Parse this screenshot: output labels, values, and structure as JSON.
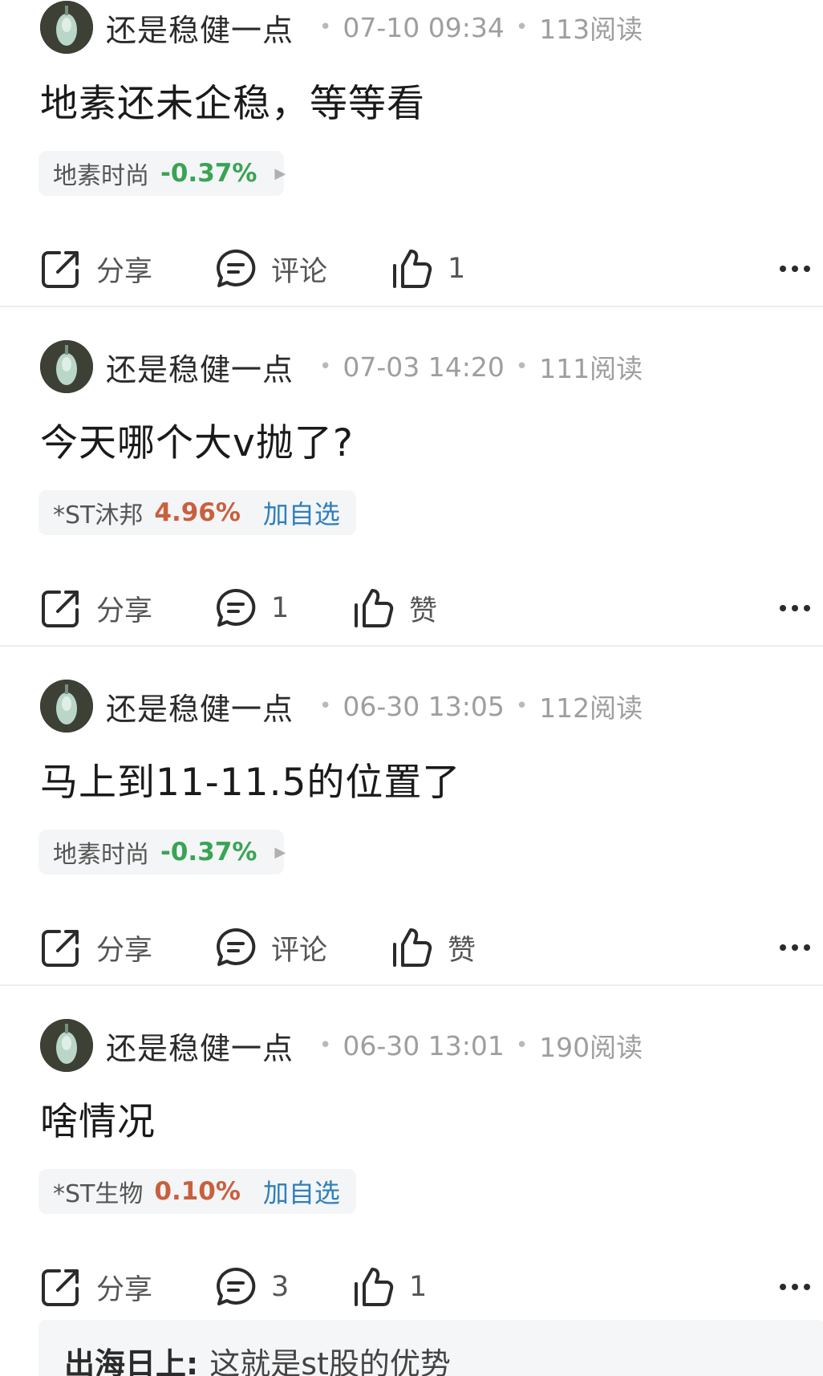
{
  "posts": [
    {
      "author": "还是稳健一点",
      "time": "07-10 09:34",
      "reads": "113阅读",
      "content": "地素还未企稳，等等看",
      "stock": {
        "name": "地素时尚",
        "change": "-0.37%",
        "direction": "down",
        "add_label": ""
      },
      "share_label": "分享",
      "comment_label": "评论",
      "like_label": "1"
    },
    {
      "author": "还是稳健一点",
      "time": "07-03 14:20",
      "reads": "111阅读",
      "content": "今天哪个大v抛了?",
      "stock": {
        "name": "*ST沐邦",
        "change": "4.96%",
        "direction": "up",
        "add_label": "加自选"
      },
      "share_label": "分享",
      "comment_label": "1",
      "like_label": "赞"
    },
    {
      "author": "还是稳健一点",
      "time": "06-30 13:05",
      "reads": "112阅读",
      "content": "马上到11-11.5的位置了",
      "stock": {
        "name": "地素时尚",
        "change": "-0.37%",
        "direction": "down",
        "add_label": ""
      },
      "share_label": "分享",
      "comment_label": "评论",
      "like_label": "赞"
    },
    {
      "author": "还是稳健一点",
      "time": "06-30 13:01",
      "reads": "190阅读",
      "content": "啥情况",
      "stock": {
        "name": "*ST生物",
        "change": "0.10%",
        "direction": "up",
        "add_label": "加自选"
      },
      "share_label": "分享",
      "comment_label": "3",
      "like_label": "1"
    }
  ],
  "reply": {
    "author": "出海日上:",
    "text": "这就是st股的优势"
  },
  "colors": {
    "down": "#3aa356",
    "up": "#c8603e",
    "link": "#2f7fbd"
  },
  "icons": {
    "share": "share-icon",
    "comment": "comment-icon",
    "like": "thumbs-up-icon",
    "more": "more-icon",
    "stock_arrow": "triangle-right-icon"
  }
}
